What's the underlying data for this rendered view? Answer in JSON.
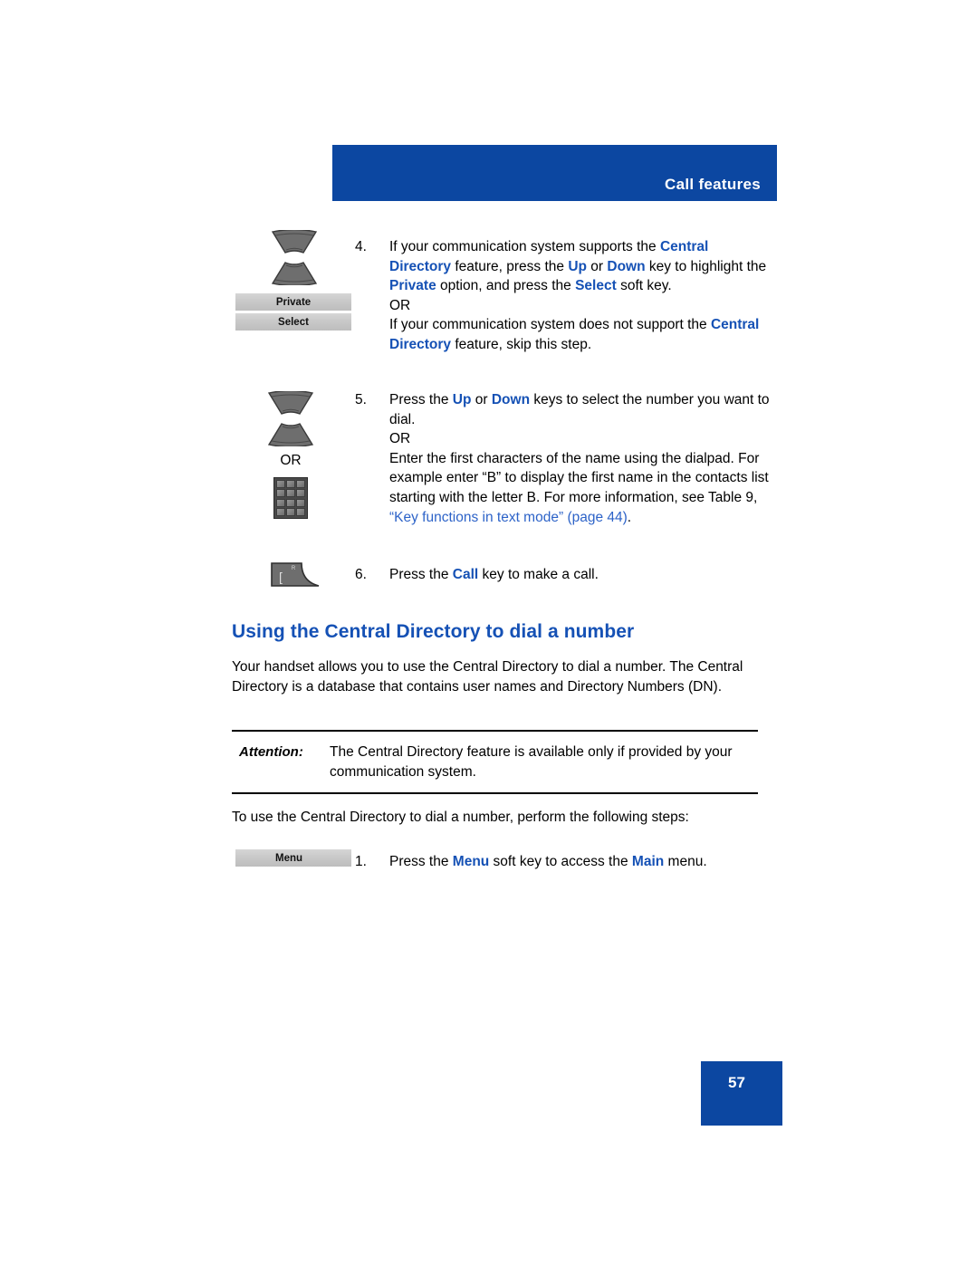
{
  "header": {
    "title": "Call features"
  },
  "steps": [
    {
      "number": "4.",
      "icons": [
        "nav-up-down-key",
        "softkey-private",
        "softkey-select"
      ],
      "softkeys": [
        "Private",
        "Select"
      ],
      "lines": [
        "If your communication system supports the Central Directory feature, press the Up or Down key to highlight the Private option, and press the Select soft key.",
        "OR",
        "If your communication system does not support the Central Directory feature, skip this step."
      ]
    },
    {
      "number": "5.",
      "icons": [
        "nav-up-down-key",
        "or-label",
        "dialpad-icon"
      ],
      "or_label": "OR",
      "lines": [
        "Press the Up or Down keys to select the number you want to dial.",
        "OR",
        "Enter the first characters of the name using the dialpad. For example enter “B” to display the first name in the contacts list starting with the letter B. For more information, see Table 9, “Key functions in text mode” (page 44)."
      ],
      "link_text": "“Key functions in text mode”",
      "link_page": "(page 44)"
    },
    {
      "number": "6.",
      "icons": [
        "call-key-icon"
      ],
      "lines": [
        "Press the Call key to make a call."
      ]
    }
  ],
  "section": {
    "heading": "Using the Central Directory to dial a number",
    "intro": "Your handset allows you to use the Central Directory to dial a number. The Central Directory is a database that contains user names and Directory Numbers (DN).",
    "attention_label": "Attention:",
    "attention_text": "The Central Directory feature is available only if provided by your communication system.",
    "steps_intro": "To use the Central Directory to dial a number, perform the following steps:",
    "step1_number": "1.",
    "step1_softkey": "Menu",
    "step1_text": "Press the Menu soft key to access the Main menu."
  },
  "footer": {
    "page_number": "57"
  },
  "colors": {
    "brand_blue": "#0C47A1",
    "text_blue": "#1551B5",
    "link_blue": "#2D63C8",
    "softkey_grey": "#C9C9C9"
  }
}
